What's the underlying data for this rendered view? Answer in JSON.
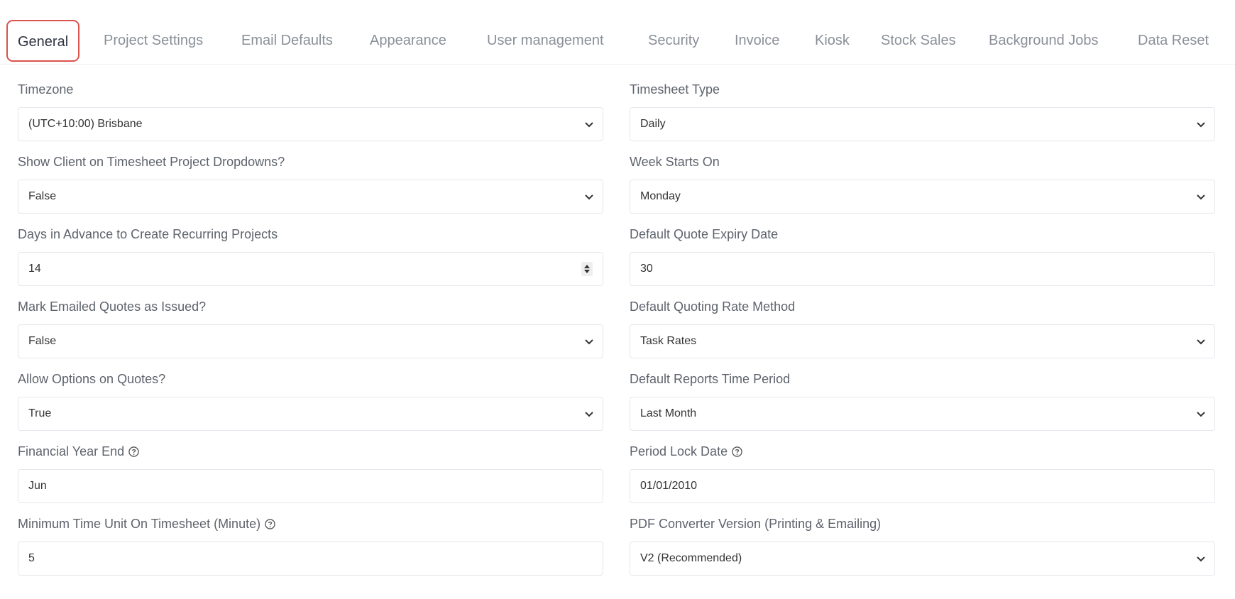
{
  "tabs": [
    {
      "label": "General",
      "active": true
    },
    {
      "label": "Project Settings"
    },
    {
      "label": "Email Defaults"
    },
    {
      "label": "Appearance"
    },
    {
      "label": "User management"
    },
    {
      "label": "Security"
    },
    {
      "label": "Invoice"
    },
    {
      "label": "Kiosk"
    },
    {
      "label": "Stock Sales"
    },
    {
      "label": "Background Jobs"
    },
    {
      "label": "Data Reset"
    }
  ],
  "left": {
    "timezone": {
      "label": "Timezone",
      "value": "(UTC+10:00) Brisbane"
    },
    "show_client": {
      "label": "Show Client on Timesheet Project Dropdowns?",
      "value": "False"
    },
    "days_advance": {
      "label": "Days in Advance to Create Recurring Projects",
      "value": "14"
    },
    "mark_emailed": {
      "label": "Mark Emailed Quotes as Issued?",
      "value": "False"
    },
    "allow_options": {
      "label": "Allow Options on Quotes?",
      "value": "True"
    },
    "financial_year_end": {
      "label": "Financial Year End",
      "value": "Jun"
    },
    "min_time_unit": {
      "label": "Minimum Time Unit On Timesheet (Minute)",
      "value": "5"
    }
  },
  "right": {
    "timesheet_type": {
      "label": "Timesheet Type",
      "value": "Daily"
    },
    "week_starts": {
      "label": "Week Starts On",
      "value": "Monday"
    },
    "quote_expiry": {
      "label": "Default Quote Expiry Date",
      "value": "30"
    },
    "quoting_rate": {
      "label": "Default Quoting Rate Method",
      "value": "Task Rates"
    },
    "reports_period": {
      "label": "Default Reports Time Period",
      "value": "Last Month"
    },
    "period_lock": {
      "label": "Period Lock Date",
      "value": "01/01/2010"
    },
    "pdf_converter": {
      "label": "PDF Converter Version (Printing & Emailing)",
      "value": "V2 (Recommended)"
    }
  },
  "colors": {
    "active_tab_border": "#d9534f",
    "tab_text": "#8a8f98",
    "active_tab_text": "#2f3340"
  }
}
